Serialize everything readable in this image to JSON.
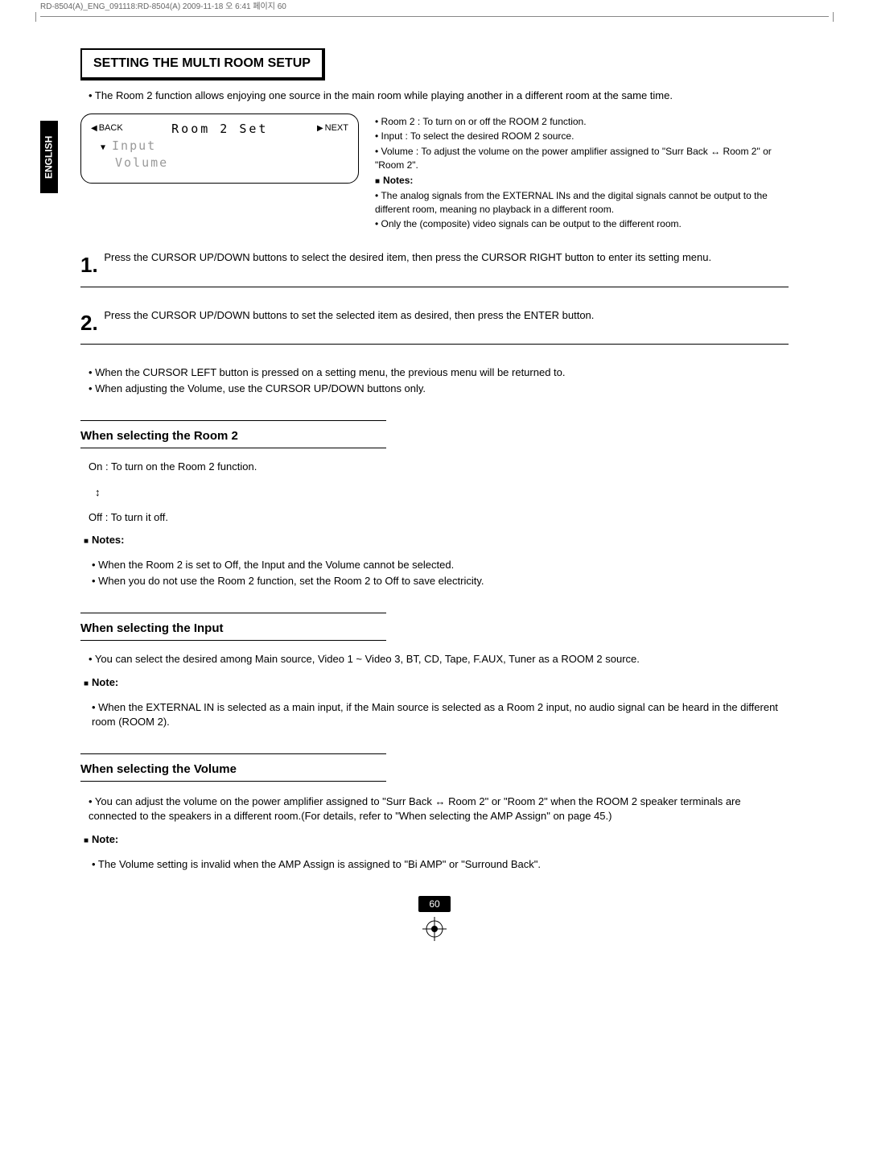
{
  "doc_header": "RD-8504(A)_ENG_091118:RD-8504(A)  2009-11-18  오   6:41  페이지 60",
  "lang_tab": "ENGLISH",
  "title": "SETTING THE MULTI ROOM SETUP",
  "intro": "• The Room 2 function allows enjoying one source in the main room while playing another in a different room at the same time.",
  "display": {
    "back": "BACK",
    "title": "Room 2 Set",
    "next": "NEXT",
    "lines": [
      "Input",
      "Volume"
    ]
  },
  "right_bullets": [
    "• Room 2 : To turn on or off the ROOM 2 function.",
    "• Input : To select the desired ROOM 2 source.",
    "• Volume : To adjust the volume on the power amplifier assigned to \"Surr Back ↔ Room 2\" or \"Room 2\"."
  ],
  "right_notes_head": "Notes:",
  "right_notes": [
    "• The analog signals from the EXTERNAL INs and the digital signals cannot be output to the different room, meaning no playback in a different room.",
    "• Only the (composite) video signals can be output to the different room."
  ],
  "steps": [
    {
      "num": "1.",
      "text": "Press the CURSOR UP/DOWN buttons to select the desired item, then press the CURSOR RIGHT button to enter its setting menu."
    },
    {
      "num": "2.",
      "text": "Press the CURSOR UP/DOWN buttons to set the selected item as desired, then press the ENTER button."
    }
  ],
  "post_step_bullets": [
    "• When the CURSOR LEFT button is pressed on a setting menu, the previous menu will be returned to.",
    "• When adjusting the Volume, use the CURSOR UP/DOWN buttons only."
  ],
  "sections": [
    {
      "heading": "When selecting the Room 2",
      "body": [
        "On : To turn on the Room 2 function.",
        "↕",
        "Off : To turn it off."
      ],
      "notes_head": "Notes:",
      "notes": [
        "• When the Room 2 is set to Off, the Input and the Volume cannot be selected.",
        "• When you do not use the Room 2 function, set the Room 2 to Off to save electricity."
      ]
    },
    {
      "heading": "When selecting the Input",
      "body": [
        "• You can select the desired among Main source, Video 1 ~ Video 3, BT, CD, Tape, F.AUX, Tuner  as a ROOM 2 source."
      ],
      "notes_head": "Note:",
      "notes": [
        "• When the EXTERNAL IN is selected as a main input, if the Main source is selected as a Room 2 input, no audio signal can be heard in the different room (ROOM 2)."
      ]
    },
    {
      "heading": "When selecting the Volume",
      "body": [
        "• You can adjust the volume on the power amplifier assigned to \"Surr Back ↔ Room 2\" or \"Room 2\" when the ROOM 2 speaker terminals are connected to the speakers in a different room.(For details, refer to \"When selecting the AMP Assign\" on page 45.)"
      ],
      "notes_head": "Note:",
      "notes": [
        "• The Volume setting is invalid when the AMP Assign is assigned to \"Bi AMP\" or \"Surround Back\"."
      ]
    }
  ],
  "page_number": "60"
}
